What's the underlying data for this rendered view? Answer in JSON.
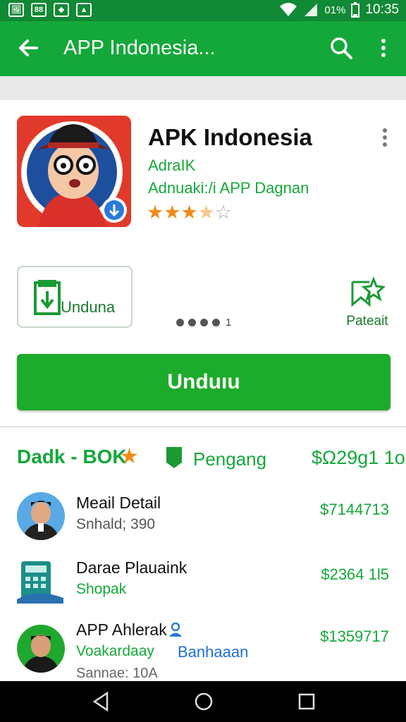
{
  "status_bar": {
    "notif_icons": [
      "image-icon",
      "sim-icon",
      "shield-icon",
      "bag-icon"
    ],
    "notif_glyphs": [
      "🖼",
      "88",
      "◆",
      "▲"
    ],
    "battery": "01%",
    "time": "10:35"
  },
  "app_bar": {
    "title": "APP Indonesia..."
  },
  "app": {
    "name": "APK Indonesia",
    "developer": "AdraIK",
    "category": "Adnuaki:/i APP Dagnan",
    "rating": 3.5
  },
  "buttons": {
    "small_download": "Unduna",
    "screenshot_count": "1",
    "wishlist": "Pateait",
    "install": "Unduıu"
  },
  "list": {
    "header_left": "Dadk - BOK",
    "header_mid": "Pengang",
    "header_right": "$Ω29ɡ1 1o",
    "rows": [
      {
        "title": "Meail Detail",
        "subtitle": "Snhald; 390",
        "price": "$7144713"
      },
      {
        "title": "Darae Plauaink",
        "subtitle": "Shopak",
        "price": "$2364 1l5"
      },
      {
        "title": "APP Ahlerak",
        "subtitle": "Voakardaay",
        "subtitle2": "Banhaaan",
        "extra": "Sannae: 10A",
        "price": "$1359717"
      }
    ]
  },
  "colors": {
    "app_bar": "#14a83a",
    "status_bar": "#108a34",
    "install_button": "#1cab2a",
    "accent_text": "#14a83a",
    "star": "#f18a15"
  }
}
